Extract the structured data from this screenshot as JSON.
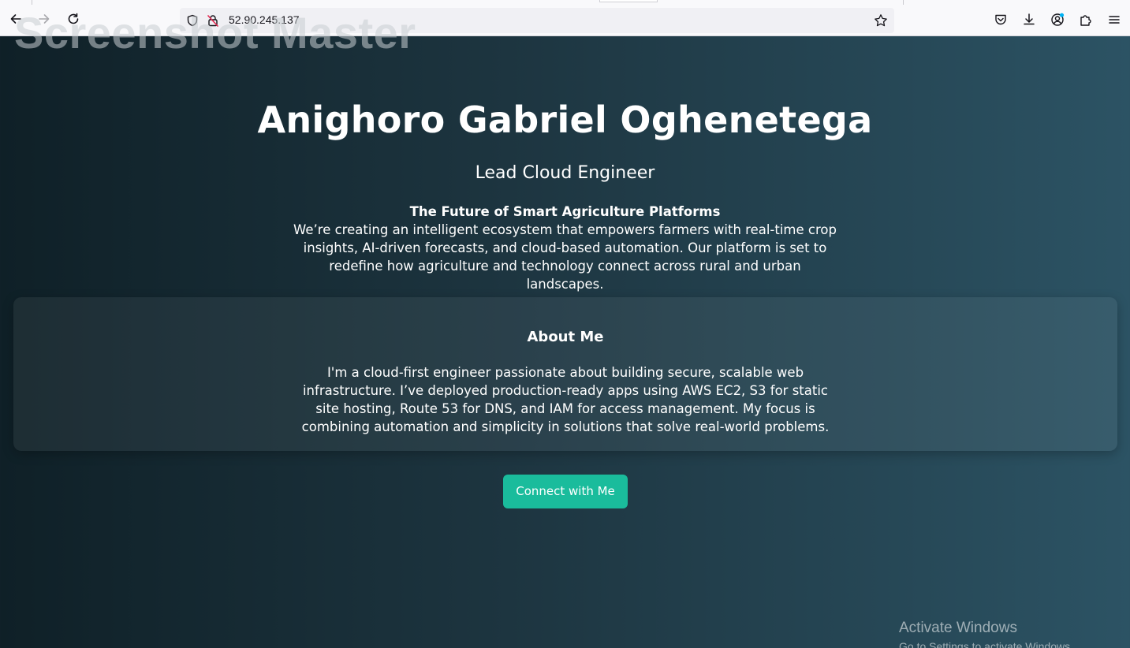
{
  "browser": {
    "url": "52.90.245.137",
    "icons": {
      "back": "arrow-left-icon",
      "forward": "arrow-right-icon",
      "reload": "reload-icon",
      "site_info": "shield-icon",
      "insecure": "lock-strike-icon",
      "bookmark": "star-icon",
      "pocket": "pocket-icon",
      "downloads": "download-icon",
      "account": "account-icon",
      "extensions": "puzzle-icon",
      "menu": "hamburger-menu-icon"
    }
  },
  "overlay": {
    "app_watermark": "Screenshot Master",
    "activate_title": "Activate Windows",
    "activate_subtitle": "Go to Settings to activate Windows."
  },
  "hero": {
    "name": "Anighoro Gabriel Oghenetega",
    "role": "Lead Cloud Engineer",
    "vision_title": "The Future of Smart Agriculture Platforms",
    "vision_text": "We’re creating an intelligent ecosystem that empowers farmers with real-time crop insights, AI-driven forecasts, and cloud-based automation. Our platform is set to redefine how agriculture and technology connect across rural and urban landscapes."
  },
  "about": {
    "heading": "About Me",
    "body": "I'm a cloud-first engineer passionate about building secure, scalable web infrastructure. I’ve deployed production-ready apps using AWS EC2, S3 for static site hosting, Route 53 for DNS, and IAM for access management. My focus is combining automation and simplicity in solutions that solve real-world problems."
  },
  "cta": {
    "label": "Connect with Me"
  },
  "colors": {
    "background_start": "#0f2027",
    "background_end": "#2c5364",
    "accent": "#1abc9c",
    "text": "#ffffff"
  }
}
